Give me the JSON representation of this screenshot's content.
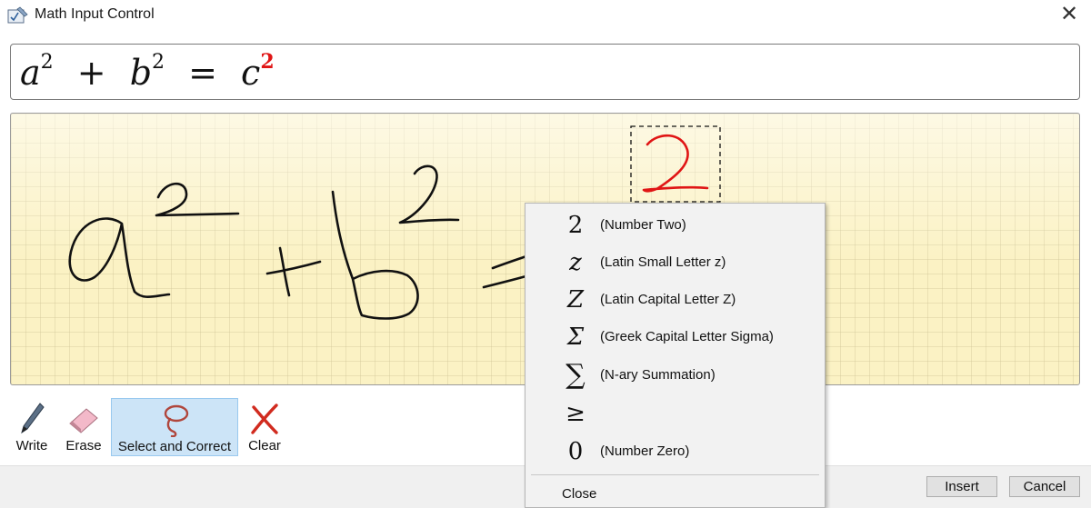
{
  "window": {
    "title": "Math Input Control",
    "icon": "math-input-app-icon",
    "close_icon": "close-icon"
  },
  "preview": {
    "terms": [
      {
        "base": "a",
        "exp": "2"
      },
      {
        "op": "+"
      },
      {
        "base": "b",
        "exp": "2"
      },
      {
        "op": "="
      },
      {
        "base": "c",
        "exp": "2",
        "exp_color": "#e01515"
      }
    ]
  },
  "pad": {
    "ink_color": "#111111",
    "selected_ink_color": "#e01515",
    "selection_icon": "dashed-selection-box"
  },
  "toolbar": {
    "write": {
      "label": "Write",
      "icon": "pen-icon"
    },
    "erase": {
      "label": "Erase",
      "icon": "eraser-icon"
    },
    "select": {
      "label": "Select and Correct",
      "icon": "lasso-icon",
      "selected": true
    },
    "clear": {
      "label": "Clear",
      "icon": "red-x-icon"
    }
  },
  "buttons": {
    "insert": "Insert",
    "cancel": "Cancel"
  },
  "context_menu": {
    "items": [
      {
        "symbol": "2",
        "description": "(Number Two)"
      },
      {
        "symbol": "z",
        "description": "(Latin Small Letter z)"
      },
      {
        "symbol": "Z",
        "description": "(Latin Capital Letter Z)"
      },
      {
        "symbol": "Σ",
        "description": "(Greek Capital Letter Sigma)"
      },
      {
        "symbol": "∑",
        "description": "(N-ary Summation)"
      },
      {
        "symbol": "≥",
        "description": ""
      },
      {
        "symbol": "0",
        "description": "(Number Zero)"
      }
    ],
    "close_label": "Close"
  },
  "colors": {
    "pad_background": "#fbf2c4",
    "selection_highlight": "#cce4f7",
    "accent_red": "#e01515"
  }
}
